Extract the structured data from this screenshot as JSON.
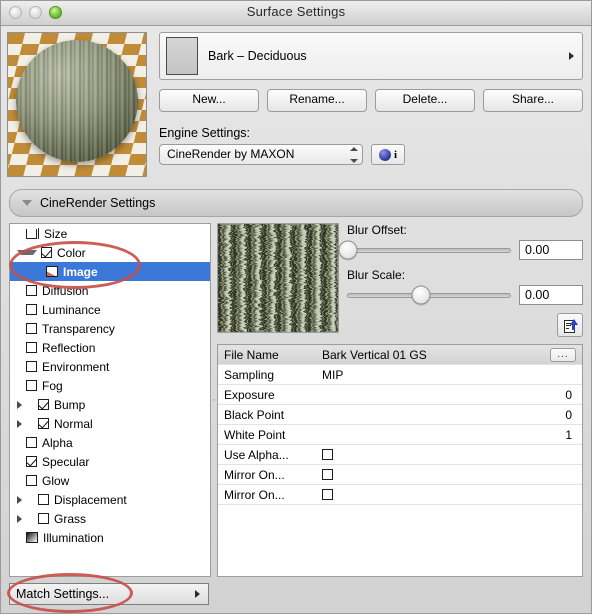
{
  "window": {
    "title": "Surface Settings",
    "traffic_lights": [
      "close",
      "minimize",
      "zoom"
    ]
  },
  "material": {
    "name": "Bark – Deciduous",
    "buttons": [
      {
        "label": "New...",
        "name": "new-button"
      },
      {
        "label": "Rename...",
        "name": "rename-button"
      },
      {
        "label": "Delete...",
        "name": "delete-button"
      },
      {
        "label": "Share...",
        "name": "share-button"
      }
    ]
  },
  "engine": {
    "label": "Engine Settings:",
    "selected": "CineRender by MAXON",
    "info_glyph": "i"
  },
  "section": {
    "title": "CineRender Settings"
  },
  "channels": [
    {
      "label": "Size",
      "icon": "size-icon",
      "checkbox": null,
      "disclosure": "none",
      "selected": false,
      "indent": false
    },
    {
      "label": "Color",
      "icon": null,
      "checkbox": true,
      "disclosure": "down",
      "selected": false,
      "indent": false
    },
    {
      "label": "Image",
      "icon": "image-icon",
      "checkbox": null,
      "disclosure": "none",
      "selected": true,
      "indent": true
    },
    {
      "label": "Diffusion",
      "icon": null,
      "checkbox": false,
      "disclosure": "none",
      "selected": false,
      "indent": false
    },
    {
      "label": "Luminance",
      "icon": null,
      "checkbox": false,
      "disclosure": "none",
      "selected": false,
      "indent": false
    },
    {
      "label": "Transparency",
      "icon": null,
      "checkbox": false,
      "disclosure": "none",
      "selected": false,
      "indent": false
    },
    {
      "label": "Reflection",
      "icon": null,
      "checkbox": false,
      "disclosure": "none",
      "selected": false,
      "indent": false
    },
    {
      "label": "Environment",
      "icon": null,
      "checkbox": false,
      "disclosure": "none",
      "selected": false,
      "indent": false
    },
    {
      "label": "Fog",
      "icon": null,
      "checkbox": false,
      "disclosure": "none",
      "selected": false,
      "indent": false
    },
    {
      "label": "Bump",
      "icon": null,
      "checkbox": true,
      "disclosure": "right",
      "selected": false,
      "indent": false
    },
    {
      "label": "Normal",
      "icon": null,
      "checkbox": true,
      "disclosure": "right",
      "selected": false,
      "indent": false
    },
    {
      "label": "Alpha",
      "icon": null,
      "checkbox": false,
      "disclosure": "none",
      "selected": false,
      "indent": false
    },
    {
      "label": "Specular",
      "icon": null,
      "checkbox": true,
      "disclosure": "none",
      "selected": false,
      "indent": false
    },
    {
      "label": "Glow",
      "icon": null,
      "checkbox": false,
      "disclosure": "none",
      "selected": false,
      "indent": false
    },
    {
      "label": "Displacement",
      "icon": null,
      "checkbox": false,
      "disclosure": "right",
      "selected": false,
      "indent": false
    },
    {
      "label": "Grass",
      "icon": null,
      "checkbox": false,
      "disclosure": "right",
      "selected": false,
      "indent": false
    },
    {
      "label": "Illumination",
      "icon": "illumination-icon",
      "checkbox": null,
      "disclosure": "none",
      "selected": false,
      "indent": false
    }
  ],
  "sliders": [
    {
      "label": "Blur Offset:",
      "value": "0.00",
      "percent": 0
    },
    {
      "label": "Blur Scale:",
      "value": "0.00",
      "percent": 45
    }
  ],
  "properties": {
    "rows": [
      {
        "key": "File Name",
        "value": "Bark Vertical 01 GS",
        "type": "text-with-browse",
        "browse_label": "..."
      },
      {
        "key": "Sampling",
        "value": "MIP",
        "type": "text"
      },
      {
        "key": "Exposure",
        "value": "0",
        "type": "number"
      },
      {
        "key": "Black Point",
        "value": "0",
        "type": "number"
      },
      {
        "key": "White Point",
        "value": "1",
        "type": "number"
      },
      {
        "key": "Use Alpha...",
        "value": "",
        "type": "checkbox",
        "checked": false
      },
      {
        "key": "Mirror On...",
        "value": "",
        "type": "checkbox",
        "checked": false
      },
      {
        "key": "Mirror On...",
        "value": "",
        "type": "checkbox",
        "checked": false
      }
    ]
  },
  "footer": {
    "match_settings": "Match Settings..."
  },
  "annotations": {
    "color": "#c8504a",
    "shapes": [
      "ellipse-around-color-image",
      "ellipse-around-match-settings"
    ]
  }
}
